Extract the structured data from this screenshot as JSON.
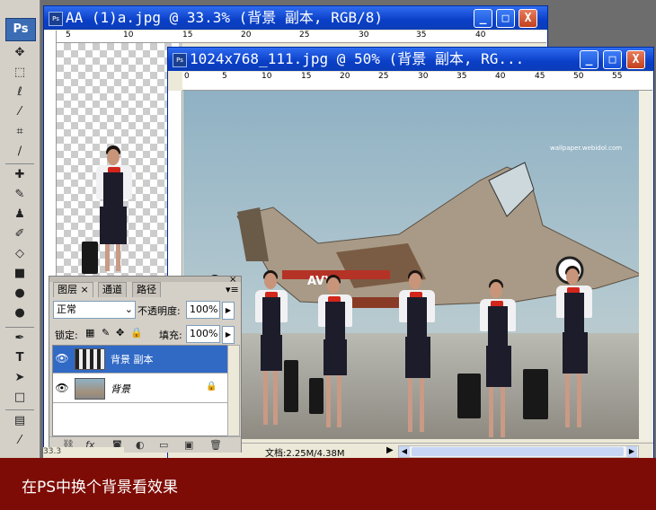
{
  "app": {
    "logo": "Ps"
  },
  "toolbox": {
    "tools": [
      "move-tool",
      "marquee-tool",
      "lasso-tool",
      "magic-wand-tool",
      "crop-tool",
      "slice-tool",
      "healing-brush-tool",
      "brush-tool",
      "clone-stamp-tool",
      "history-brush-tool",
      "eraser-tool",
      "gradient-tool",
      "blur-tool",
      "dodge-tool",
      "pen-tool",
      "type-tool",
      "path-selection-tool",
      "shape-tool",
      "notes-tool",
      "eyedropper-tool"
    ]
  },
  "window_back": {
    "title": "AA (1)a.jpg @ 33.3% (背景 副本, RGB/8)",
    "ruler_ticks": [
      "5",
      "10",
      "15",
      "20",
      "25",
      "30",
      "35",
      "40"
    ],
    "buttons": {
      "minimize": "_",
      "maximize": "□",
      "close": "X"
    }
  },
  "window_front": {
    "title": "1024x768_111.jpg @ 50% (背景 副本, RG...",
    "ruler_ticks": [
      "0",
      "5",
      "10",
      "15",
      "20",
      "25",
      "30",
      "35",
      "40",
      "45",
      "50",
      "55"
    ],
    "watermark": "wallpaper.webidol.com",
    "status": "文档:2.25M/4.38M",
    "buttons": {
      "minimize": "_",
      "maximize": "□",
      "close": "X"
    }
  },
  "layers_panel": {
    "tabs": [
      "图层",
      "通道",
      "路径"
    ],
    "blend_mode": "正常",
    "opacity_label": "不透明度:",
    "opacity_value": "100%",
    "lock_label": "锁定:",
    "fill_label": "填充:",
    "fill_value": "100%",
    "layers": [
      {
        "name": "背景 副本",
        "selected": true
      },
      {
        "name": "背景",
        "selected": false,
        "locked": true
      }
    ],
    "bottom_icons": [
      "link-icon",
      "fx-icon",
      "mask-icon",
      "adjustment-icon",
      "group-icon",
      "new-layer-icon",
      "trash-icon"
    ]
  },
  "zoom_left": "33.3",
  "caption": "在PS中换个背景看效果",
  "colors": {
    "title_bar": "#0a3fc7",
    "caption_bar": "#7e0c06",
    "panel": "#d4d0c8",
    "selected_layer": "#316ac5"
  }
}
